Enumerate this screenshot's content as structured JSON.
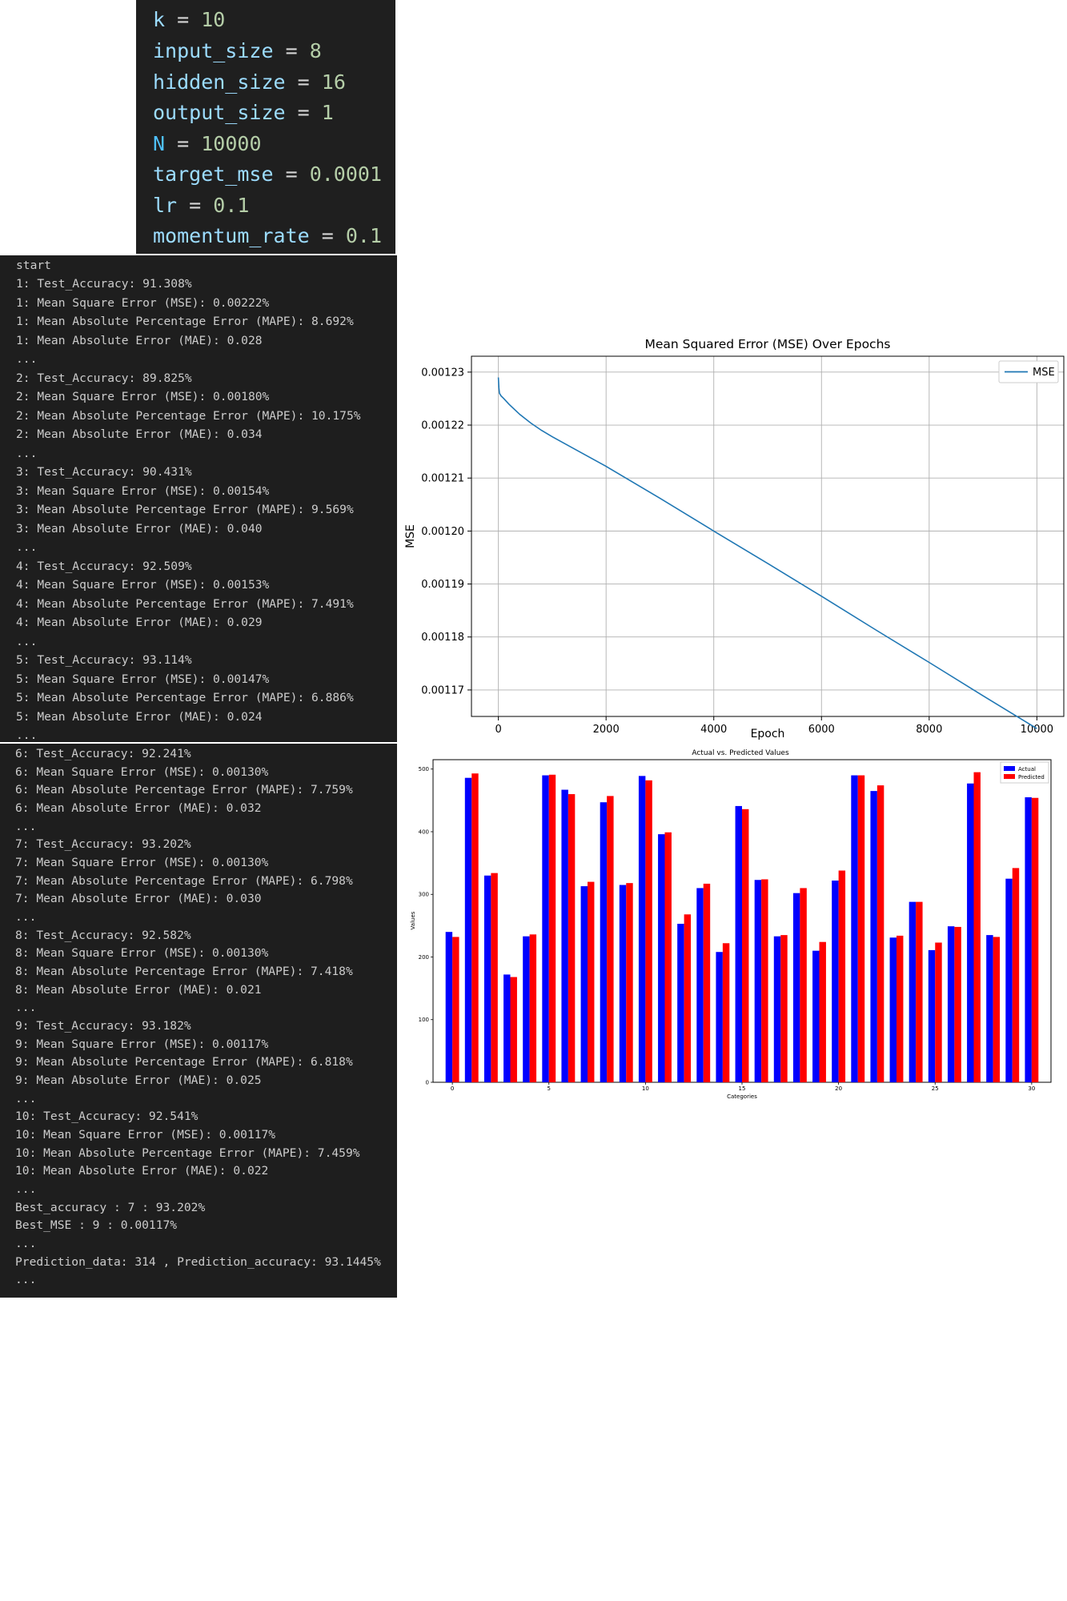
{
  "code": [
    {
      "name": "k",
      "value": "10",
      "name_color": "#9cdcfe"
    },
    {
      "name": "input_size",
      "value": "8",
      "name_color": "#9cdcfe"
    },
    {
      "name": "hidden_size",
      "value": "16",
      "name_color": "#9cdcfe"
    },
    {
      "name": "output_size",
      "value": "1",
      "name_color": "#9cdcfe"
    },
    {
      "name": "N",
      "value": "10000",
      "name_color": "#4fc1ff"
    },
    {
      "name": "target_mse",
      "value": "0.0001",
      "name_color": "#9cdcfe"
    },
    {
      "name": "lr",
      "value": "0.1",
      "name_color": "#9cdcfe"
    },
    {
      "name": "momentum_rate",
      "value": "0.1",
      "name_color": "#9cdcfe"
    }
  ],
  "code_operator": "=",
  "console_1": [
    "start",
    "1: Test_Accuracy: 91.308%",
    "1: Mean Square Error (MSE): 0.00222%",
    "1: Mean Absolute Percentage Error (MAPE): 8.692%",
    "1: Mean Absolute Error (MAE): 0.028",
    "...",
    "2: Test_Accuracy: 89.825%",
    "2: Mean Square Error (MSE): 0.00180%",
    "2: Mean Absolute Percentage Error (MAPE): 10.175%",
    "2: Mean Absolute Error (MAE): 0.034",
    "...",
    "3: Test_Accuracy: 90.431%",
    "3: Mean Square Error (MSE): 0.00154%",
    "3: Mean Absolute Percentage Error (MAPE): 9.569%",
    "3: Mean Absolute Error (MAE): 0.040",
    "...",
    "4: Test_Accuracy: 92.509%",
    "4: Mean Square Error (MSE): 0.00153%",
    "4: Mean Absolute Percentage Error (MAPE): 7.491%",
    "4: Mean Absolute Error (MAE): 0.029",
    "...",
    "5: Test_Accuracy: 93.114%",
    "5: Mean Square Error (MSE): 0.00147%",
    "5: Mean Absolute Percentage Error (MAPE): 6.886%",
    "5: Mean Absolute Error (MAE): 0.024",
    "..."
  ],
  "console_2": [
    "6: Test_Accuracy: 92.241%",
    "6: Mean Square Error (MSE): 0.00130%",
    "6: Mean Absolute Percentage Error (MAPE): 7.759%",
    "6: Mean Absolute Error (MAE): 0.032",
    "...",
    "7: Test_Accuracy: 93.202%",
    "7: Mean Square Error (MSE): 0.00130%",
    "7: Mean Absolute Percentage Error (MAPE): 6.798%",
    "7: Mean Absolute Error (MAE): 0.030",
    "...",
    "8: Test_Accuracy: 92.582%",
    "8: Mean Square Error (MSE): 0.00130%",
    "8: Mean Absolute Percentage Error (MAPE): 7.418%",
    "8: Mean Absolute Error (MAE): 0.021",
    "...",
    "9: Test_Accuracy: 93.182%",
    "9: Mean Square Error (MSE): 0.00117%",
    "9: Mean Absolute Percentage Error (MAPE): 6.818%",
    "9: Mean Absolute Error (MAE): 0.025",
    "...",
    "10: Test_Accuracy: 92.541%",
    "10: Mean Square Error (MSE): 0.00117%",
    "10: Mean Absolute Percentage Error (MAPE): 7.459%",
    "10: Mean Absolute Error (MAE): 0.022",
    "...",
    "Best_accuracy : 7 : 93.202%",
    "Best_MSE : 9 : 0.00117%",
    "...",
    "Prediction_data: 314 , Prediction_accuracy: 93.1445%",
    "..."
  ],
  "chart_data": [
    {
      "type": "line",
      "title": "Mean Squared Error (MSE) Over Epochs",
      "xlabel": "Epoch",
      "ylabel": "MSE",
      "xlim": [
        -500,
        10500
      ],
      "ylim": [
        0.001165,
        0.001233
      ],
      "xticks": [
        0,
        2000,
        4000,
        6000,
        8000,
        10000
      ],
      "yticks": [
        0.00117,
        0.00118,
        0.00119,
        0.0012,
        0.00121,
        0.00122,
        0.00123
      ],
      "ytick_labels": [
        "0.00117",
        "0.00118",
        "0.00119",
        "0.00120",
        "0.00121",
        "0.00122",
        "0.00123"
      ],
      "grid": true,
      "legend": "top-right",
      "series": [
        {
          "name": "MSE",
          "color": "#1f77b4",
          "x": [
            0,
            10,
            20,
            50,
            100,
            200,
            400,
            600,
            800,
            1000,
            1500,
            2000,
            3000,
            4000,
            5000,
            6000,
            7000,
            8000,
            9000,
            10000
          ],
          "y": [
            0.001229,
            0.001227,
            0.001226,
            0.0012255,
            0.001225,
            0.0012239,
            0.001222,
            0.0012204,
            0.001219,
            0.0012178,
            0.001215,
            0.0012122,
            0.0012062,
            0.0012,
            0.0011939,
            0.0011877,
            0.0011814,
            0.0011752,
            0.0011689,
            0.0011627
          ]
        }
      ]
    },
    {
      "type": "bar",
      "title": "Actual vs. Predicted Values",
      "xlabel": "Categories",
      "ylabel": "Values",
      "xlim": [
        -1,
        31
      ],
      "ylim": [
        0,
        515
      ],
      "xticks": [
        0,
        5,
        10,
        15,
        20,
        25,
        30
      ],
      "yticks": [
        0,
        100,
        200,
        300,
        400,
        500
      ],
      "legend": "top-right",
      "series": [
        {
          "name": "Actual",
          "color": "#0000ff",
          "values": [
            240,
            486,
            330,
            172,
            233,
            490,
            467,
            313,
            447,
            315,
            489,
            396,
            253,
            310,
            208,
            441,
            323,
            233,
            302,
            210,
            322,
            490,
            465,
            231,
            288,
            211,
            249,
            477,
            235,
            325,
            455
          ]
        },
        {
          "name": "Predicted",
          "color": "#ff0000",
          "values": [
            232,
            493,
            334,
            168,
            236,
            491,
            460,
            320,
            457,
            318,
            482,
            399,
            268,
            317,
            222,
            436,
            324,
            235,
            310,
            224,
            338,
            490,
            474,
            234,
            288,
            223,
            248,
            495,
            232,
            342,
            454
          ]
        }
      ]
    }
  ]
}
